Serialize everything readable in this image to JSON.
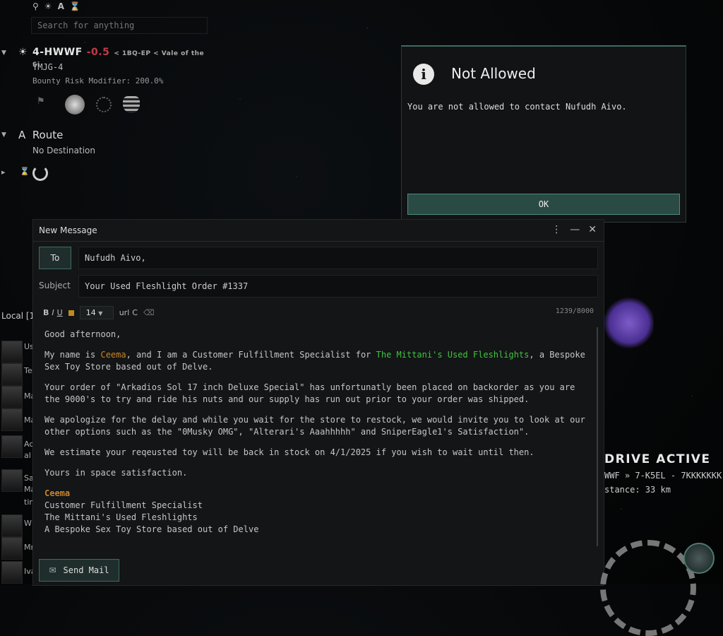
{
  "search": {
    "placeholder": "Search for anything"
  },
  "top_icons": [
    "search-icon",
    "sun-icon",
    "A",
    "hourglass-icon"
  ],
  "location": {
    "system": "4-HWWF",
    "security": "-0.5",
    "path": "< 1BQ-EP < Vale of the Si",
    "constellation": "YMJG-4",
    "bounty": "Bounty Risk Modifier: 200.0%"
  },
  "route": {
    "title": "Route",
    "marker": "A",
    "destination": "No Destination"
  },
  "local": {
    "header": "Local [1",
    "labels": [
      "Us",
      "Te",
      "Ma",
      "Ma",
      "Ac",
      "al",
      "Sa",
      "Ma",
      "tin",
      "W",
      "Mr",
      "Iva"
    ]
  },
  "modal": {
    "title": "Not Allowed",
    "message": "You are not allowed to contact Nufudh Aivo.",
    "ok_label": "OK"
  },
  "compose": {
    "title": "New Message",
    "to_label": "To",
    "to_value": "Nufudh Aivo,",
    "subject_label": "Subject",
    "subject_value": "Your Used Fleshlight Order #1337",
    "toolbar": {
      "bold": "B",
      "italic": "I",
      "underline": "U",
      "font_size": "14",
      "url": "url",
      "clear": "C"
    },
    "char_count": "1239/8000",
    "body": {
      "greeting": "Good afternoon,",
      "p1_a": "My name is ",
      "p1_name": "Ceema",
      "p1_b": ", and I am a Customer Fulfillment Specialist for ",
      "p1_corp": "The Mittani's Used Fleshlights",
      "p1_c": ", a Bespoke Sex Toy Store based out of Delve.",
      "p2": "Your order of \"Arkadios Sol 17 inch Deluxe Special\" has unfortunatly been placed on backorder as you are the 9000's to try and ride his nuts and our supply has run out prior to your order was shipped.",
      "p3": "We apologize for the delay and while you wait for the store to restock, we would invite you to look at our other options such as the \"0Musky OMG\", \"Alterari's Aaahhhhh\" and SniperEagle1's Satisfaction\".",
      "p4": "We estimate your reqeusted toy will be back in stock on 4/1/2025 if you wish to wait until then.",
      "p5": "Yours in space satisfaction.",
      "sig_name": "Ceema",
      "sig_title": "Customer Fulfillment Specialist",
      "sig_corp": "The Mittani's Used Fleshlights",
      "sig_desc": "A Bespoke Sex Toy Store based out of Delve"
    },
    "send_label": "Send Mail"
  },
  "hud": {
    "drive": "DRIVE ACTIVE",
    "route": "WWF » 7-K5EL - 7KKKKKKK",
    "distance": "stance: 33 km"
  }
}
